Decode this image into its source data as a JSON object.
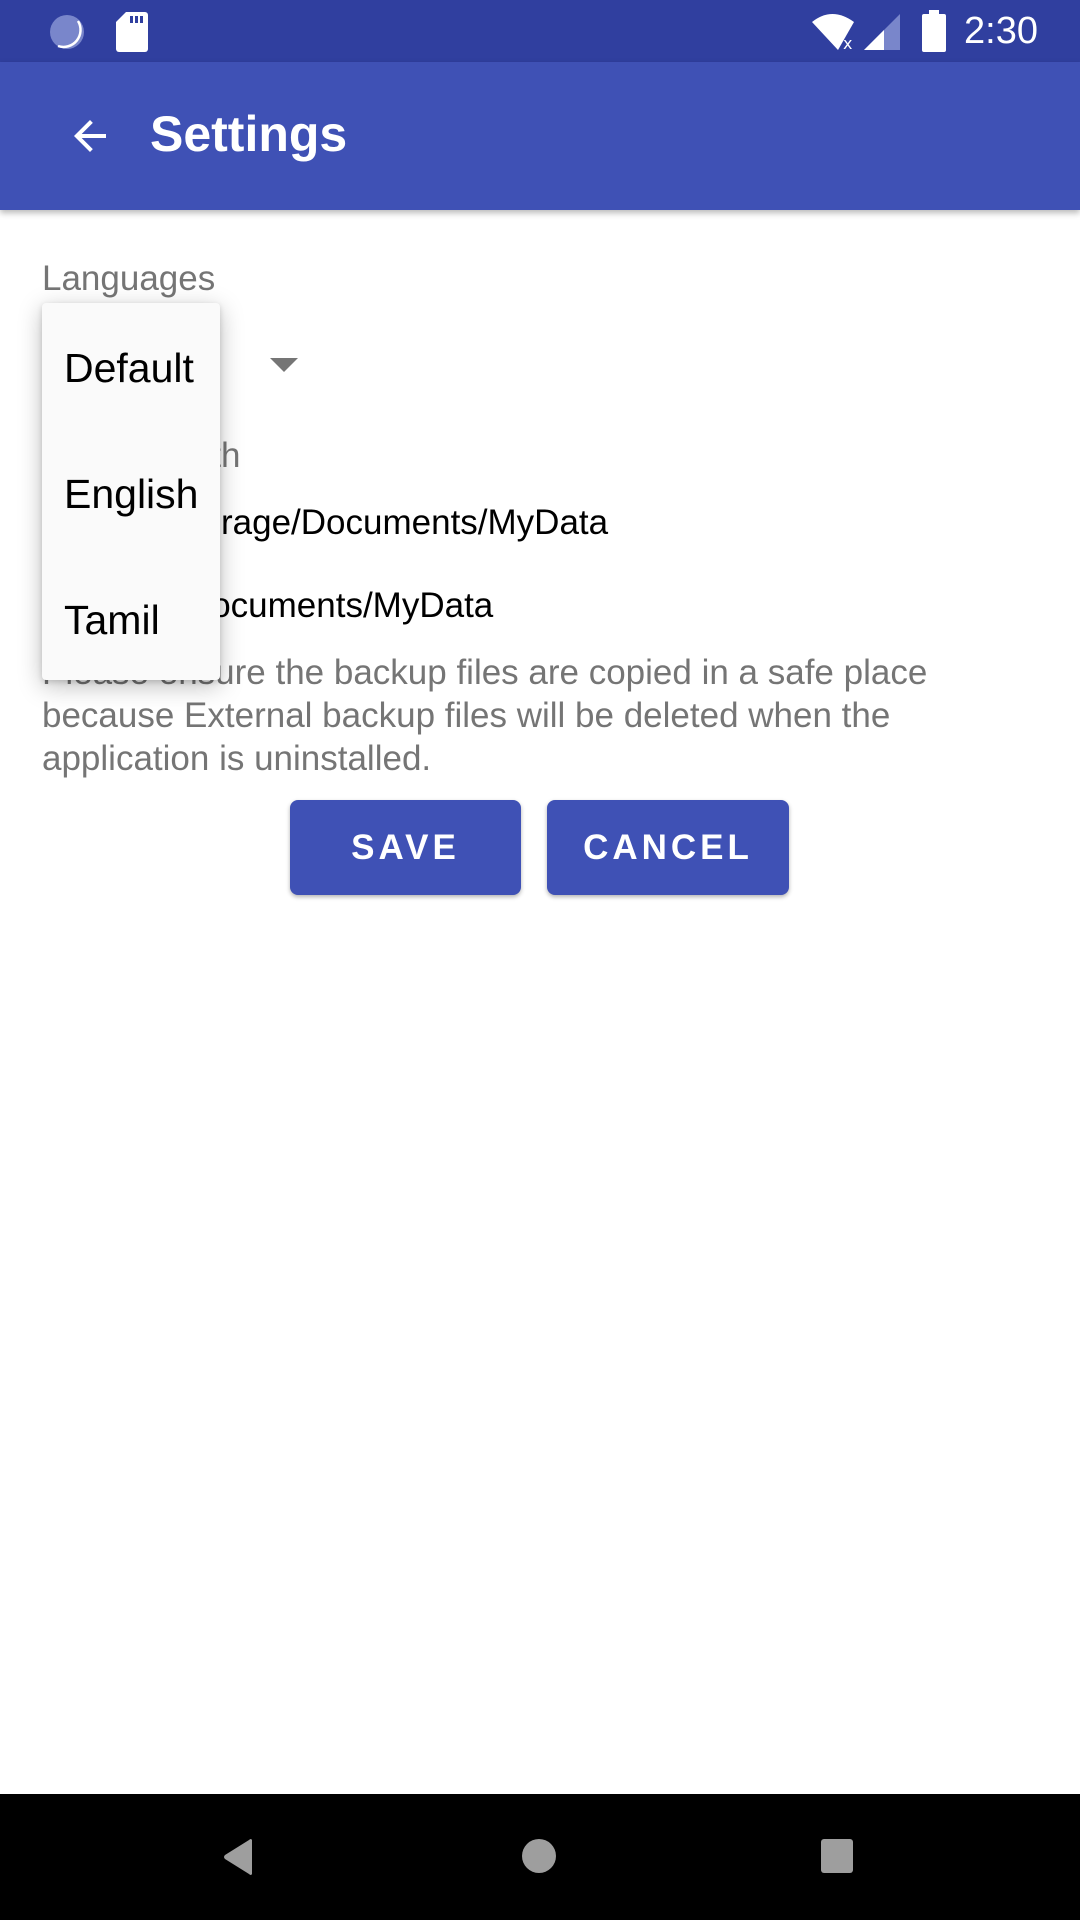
{
  "status_bar": {
    "time": "2:30",
    "icons": [
      "sync-icon",
      "sd-card-icon",
      "wifi-no-internet-icon",
      "cell-signal-icon",
      "battery-icon"
    ]
  },
  "app_bar": {
    "title": "Settings",
    "back_icon": "arrow-back-icon"
  },
  "settings": {
    "languages_label": "Languages",
    "languages_selected": "Default",
    "backup_path_label": "Backup Path",
    "internal_path": "/InternalStorage/Documents/MyData",
    "external_path": "/SDCard/Documents/MyData",
    "visible_label_fragment": "th",
    "visible_internal_fragment": "nalStorage/Documents/MyData",
    "visible_external_fragment": "ard/Documents/MyData",
    "note": "Please ensure the backup files are copied in a safe place because External backup files will be deleted when the application is uninstalled."
  },
  "dropdown": {
    "options": [
      "Default",
      "English",
      "Tamil"
    ]
  },
  "buttons": {
    "save": "SAVE",
    "cancel": "CANCEL"
  },
  "nav_bar": {
    "back": "nav-back-icon",
    "home": "nav-home-icon",
    "recents": "nav-recents-icon"
  }
}
